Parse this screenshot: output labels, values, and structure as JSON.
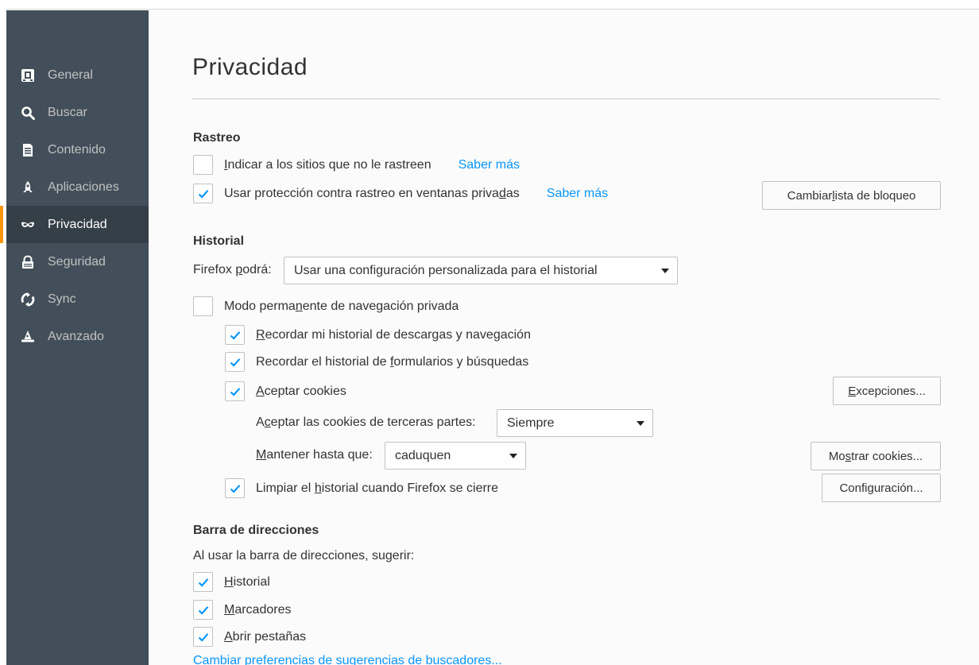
{
  "sidebar": {
    "items": [
      {
        "label": "General",
        "icon": "general-icon",
        "selected": false
      },
      {
        "label": "Buscar",
        "icon": "search-icon",
        "selected": false
      },
      {
        "label": "Contenido",
        "icon": "document-icon",
        "selected": false
      },
      {
        "label": "Aplicaciones",
        "icon": "rocket-icon",
        "selected": false
      },
      {
        "label": "Privacidad",
        "icon": "mask-icon",
        "selected": true
      },
      {
        "label": "Seguridad",
        "icon": "lock-icon",
        "selected": false
      },
      {
        "label": "Sync",
        "icon": "sync-icon",
        "selected": false
      },
      {
        "label": "Avanzado",
        "icon": "wizard-hat-icon",
        "selected": false
      }
    ],
    "selected_accent": "#ff9500",
    "background": "#424f5a"
  },
  "main": {
    "title": "Privacidad",
    "tracking": {
      "heading": "Rastreo",
      "do_not_track": {
        "pre": "",
        "key": "I",
        "post": "ndicar a los sitios que no le rastreen",
        "checked": false,
        "learn_more": "Saber más"
      },
      "private_protection": {
        "pre": "Usar protección contra rastreo en ventanas priva",
        "key": "d",
        "post": "as",
        "checked": true,
        "learn_more": "Saber más"
      },
      "change_blocklist": {
        "pre": "Cambiar ",
        "key": "l",
        "post": "ista de bloqueo"
      }
    },
    "history": {
      "heading": "Historial",
      "firefox_will": {
        "pre": "Firefox ",
        "key": "p",
        "post": "odrá:"
      },
      "history_mode_value": "Usar una configuración personalizada para el historial",
      "permanent_private": {
        "pre": "Modo perma",
        "key": "n",
        "post": "ente de navegación privada",
        "checked": false
      },
      "remember_browsing": {
        "pre": "",
        "key": "R",
        "post": "ecordar mi historial de descargas y navegación",
        "checked": true
      },
      "remember_forms": {
        "pre": "Recordar el historial de ",
        "key": "f",
        "post": "ormularios y búsquedas",
        "checked": true
      },
      "accept_cookies": {
        "pre": "",
        "key": "A",
        "post": "ceptar cookies",
        "checked": true
      },
      "exceptions_button": {
        "pre": "",
        "key": "E",
        "post": "xcepciones..."
      },
      "third_party": {
        "pre": "A",
        "key": "c",
        "post": "eptar las cookies de terceras partes:"
      },
      "third_party_value": "Siempre",
      "keep_until": {
        "pre": "",
        "key": "M",
        "post": "antener hasta que:"
      },
      "keep_until_value": "caduquen",
      "show_cookies_button": {
        "pre": "Mo",
        "key": "s",
        "post": "trar cookies..."
      },
      "clear_on_close": {
        "pre": "Limpiar el ",
        "key": "h",
        "post": "istorial cuando Firefox se cierre",
        "checked": true
      },
      "settings_button": {
        "pre": "Confi",
        "key": "g",
        "post": "uración..."
      }
    },
    "location_bar": {
      "heading": "Barra de direcciones",
      "suggest_label": "Al usar la barra de direcciones, sugerir:",
      "history": {
        "pre": "",
        "key": "H",
        "post": "istorial",
        "checked": true
      },
      "bookmarks": {
        "pre": "",
        "key": "M",
        "post": "arcadores",
        "checked": true
      },
      "open_tabs": {
        "pre": "",
        "key": "A",
        "post": "brir pestañas",
        "checked": true
      },
      "search_prefs_link": "Cambiar preferencias de sugerencias de buscadores..."
    }
  },
  "colors": {
    "link": "#0996f8",
    "check": "#0996f8",
    "text": "#333333"
  }
}
